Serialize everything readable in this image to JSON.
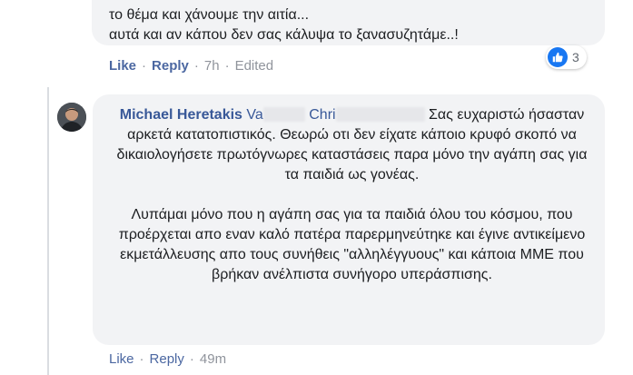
{
  "previous_comment": {
    "lines": [
      "το θέμα και χάνουμε την αιτία...",
      "αυτά και αν κάπου δεν σας κάλυψα το ξανασυζητάμε..!"
    ],
    "actions": {
      "like": "Like",
      "reply": "Reply",
      "time": "7h",
      "edited": "Edited"
    },
    "reactions": {
      "count": "3",
      "icon": "thumbs-up-icon",
      "color": "#1877f2"
    }
  },
  "reply_comment": {
    "author": "Michael Heretakis",
    "mention_visible": "Va",
    "mention_visible_mid": "Chri",
    "para1_rest": "Σας ευχαριστώ ήσασταν αρκετά κατατοπιστικός. Θεωρώ οτι δεν είχατε κάποιο κρυφό σκοπό να δικαιολογήσετε πρωτόγνωρες καταστάσεις παρα μόνο την αγάπη σας για τα παιδιά ως γονέας.",
    "para2": "Λυπάμαι μόνο που η αγάπη σας για τα παιδιά όλου του κόσμου, που προέρχεται απο εναν καλό πατέρα παρερμηνεύτηκε και έγινε αντικείμενο εκμετάλλευσης απο τους συνήθεις \"αλληλέγγυους\" και κάποια ΜΜΕ που βρήκαν ανέλπιστα συνήγορο υπεράσπισης.",
    "actions": {
      "like": "Like",
      "reply": "Reply",
      "time": "49m"
    }
  },
  "colors": {
    "link": "#385898",
    "action_link": "#4b67a1",
    "meta": "#90949c",
    "bubble": "#f2f3f5"
  }
}
